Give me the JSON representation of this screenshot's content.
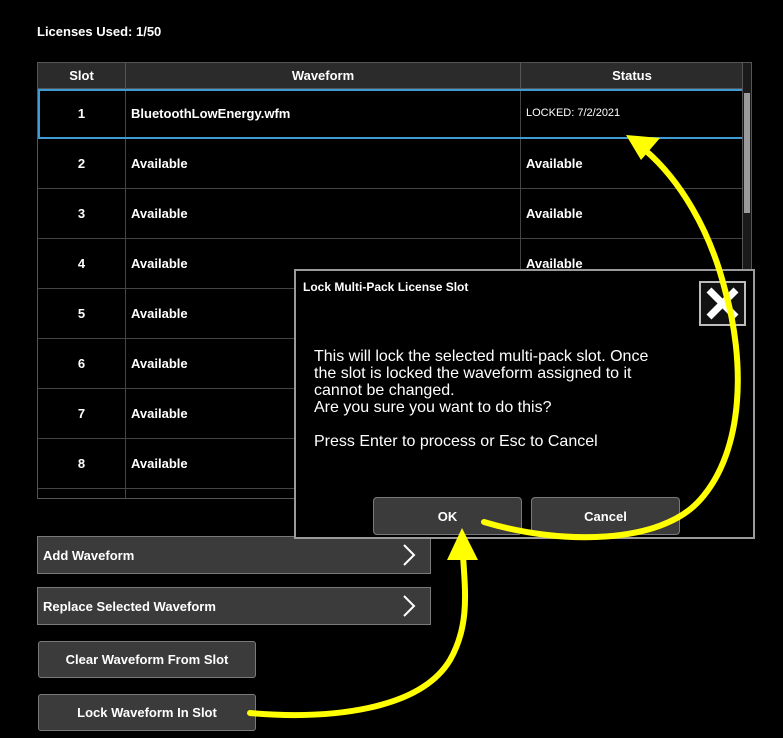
{
  "licenses_used": "Licenses Used: 1/50",
  "table": {
    "headers": {
      "slot": "Slot",
      "waveform": "Waveform",
      "status": "Status"
    },
    "rows": [
      {
        "slot": "1",
        "waveform": "BluetoothLowEnergy.wfm",
        "status": "LOCKED: 7/2/2021"
      },
      {
        "slot": "2",
        "waveform": "Available",
        "status": "Available"
      },
      {
        "slot": "3",
        "waveform": "Available",
        "status": "Available"
      },
      {
        "slot": "4",
        "waveform": "Available",
        "status": "Available"
      },
      {
        "slot": "5",
        "waveform": "Available",
        "status": ""
      },
      {
        "slot": "6",
        "waveform": "Available",
        "status": ""
      },
      {
        "slot": "7",
        "waveform": "Available",
        "status": ""
      },
      {
        "slot": "8",
        "waveform": "Available",
        "status": ""
      }
    ]
  },
  "buttons": {
    "add_waveform": "Add Waveform",
    "replace_selected": "Replace Selected Waveform",
    "clear_waveform": "Clear Waveform From Slot",
    "lock_waveform": "Lock Waveform In Slot"
  },
  "dialog": {
    "title": "Lock Multi-Pack License Slot",
    "message_lines": [
      "This will lock the selected multi-pack slot.  Once",
      "the slot is locked the waveform assigned to it",
      "cannot be changed.",
      "Are you sure you want to do this?",
      "Press Enter to process or Esc to Cancel"
    ],
    "ok": "OK",
    "cancel": "Cancel"
  },
  "icons": {
    "close": "close-x-icon",
    "chevron": "chevron-right-icon"
  },
  "colors": {
    "selection": "#3f9bd3",
    "annotation": "#ffff00"
  }
}
